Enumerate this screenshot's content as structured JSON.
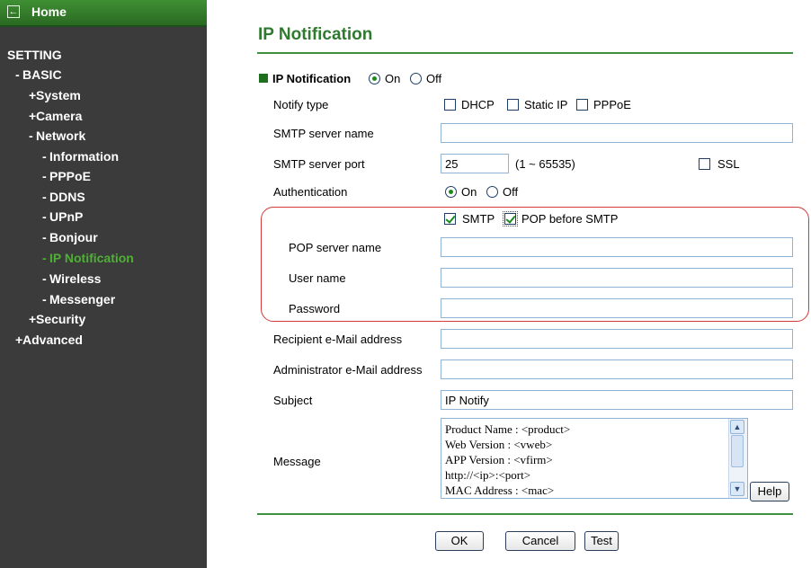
{
  "sidebar": {
    "home_label": "Home",
    "items": [
      {
        "prefix": "",
        "label": "SETTING"
      },
      {
        "prefix": "-",
        "label": "BASIC"
      },
      {
        "prefix": "+",
        "label": "System"
      },
      {
        "prefix": "+",
        "label": "Camera"
      },
      {
        "prefix": "-",
        "label": "Network"
      },
      {
        "prefix": "-",
        "label": "Information"
      },
      {
        "prefix": "-",
        "label": "PPPoE"
      },
      {
        "prefix": "-",
        "label": "DDNS"
      },
      {
        "prefix": "-",
        "label": "UPnP"
      },
      {
        "prefix": "-",
        "label": "Bonjour"
      },
      {
        "prefix": "-",
        "label": "IP Notification"
      },
      {
        "prefix": "-",
        "label": "Wireless"
      },
      {
        "prefix": "-",
        "label": "Messenger"
      },
      {
        "prefix": "+",
        "label": "Security"
      },
      {
        "prefix": "+",
        "label": "Advanced"
      }
    ]
  },
  "page": {
    "title": "IP Notification",
    "section_label": "IP Notification",
    "on_label": "On",
    "off_label": "Off",
    "notify_type_label": "Notify type",
    "notify_dhcp": "DHCP",
    "notify_static": "Static IP",
    "notify_pppoe": "PPPoE",
    "smtp_server_name_label": "SMTP server name",
    "smtp_server_name_value": "",
    "smtp_port_label": "SMTP server port",
    "smtp_port_value": "25",
    "smtp_port_range": "(1 ~ 65535)",
    "ssl_label": "SSL",
    "auth_label": "Authentication",
    "auth_on": "On",
    "auth_off": "Off",
    "smtp_cb_label": "SMTP",
    "pop_before_smtp_label": "POP before SMTP",
    "pop_server_label": "POP server name",
    "pop_server_value": "",
    "user_name_label": "User name",
    "user_name_value": "",
    "password_label": "Password",
    "password_value": "",
    "recipient_label": "Recipient e-Mail address",
    "recipient_value": "",
    "admin_label": "Administrator e-Mail address",
    "admin_value": "",
    "subject_label": "Subject",
    "subject_value": "IP Notify",
    "message_label": "Message",
    "message_lines": [
      "Product Name : <product>",
      "Web Version : <vweb>",
      "APP Version : <vfirm>",
      "http://<ip>:<port>",
      "MAC Address : <mac>"
    ],
    "help_label": "Help",
    "ok_label": "OK",
    "cancel_label": "Cancel",
    "test_label": "Test"
  }
}
